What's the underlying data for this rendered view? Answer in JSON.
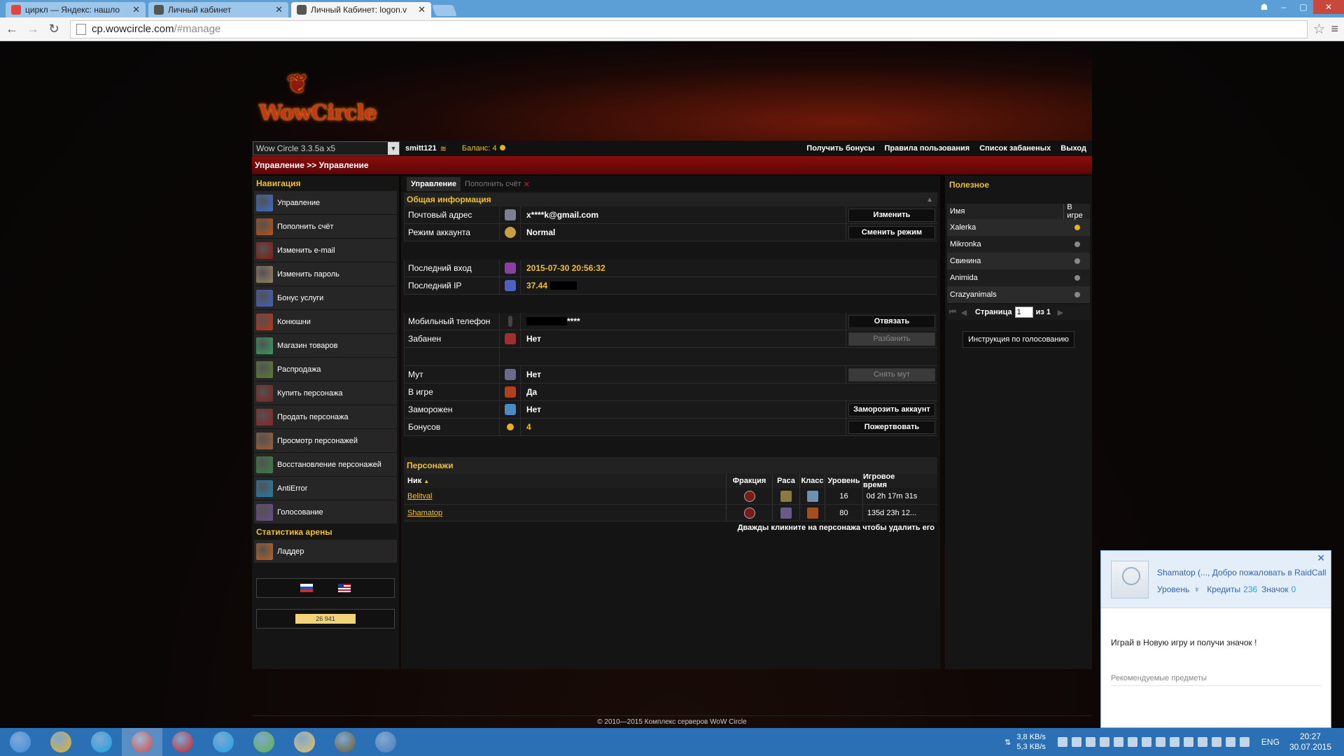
{
  "browser": {
    "tabs": [
      {
        "title": "циркл — Яндекс: нашло",
        "favicon_color": "#e0443a"
      },
      {
        "title": "Личный кабинет",
        "favicon_color": "#555555"
      },
      {
        "title": "Личный Кабинет: logon.v",
        "favicon_color": "#555555",
        "active": true
      }
    ],
    "url_host": "cp.wowcircle.com",
    "url_path": "/#manage"
  },
  "site": {
    "logo_text": "WowCircle",
    "realm": "Wow Circle 3.3.5a x5",
    "username": "smitt121",
    "balance_label": "Баланс:",
    "balance_value": "4",
    "top_menu": [
      "Получить бонусы",
      "Правила пользования",
      "Список забаненых",
      "Выход"
    ],
    "breadcrumb": "Управление >> Управление",
    "accent_color": "#f0c030",
    "header_red": "#8a0c0c"
  },
  "nav": {
    "title": "Навигация",
    "items": [
      {
        "label": "Управление",
        "icon": "manage-icon",
        "color": "#3a6bd0"
      },
      {
        "label": "Пополнить счёт",
        "icon": "deposit-icon",
        "color": "#c05010"
      },
      {
        "label": "Изменить e-mail",
        "icon": "email-icon",
        "color": "#8a1a10"
      },
      {
        "label": "Изменить пароль",
        "icon": "password-icon",
        "color": "#9a8060"
      },
      {
        "label": "Бонус услуги",
        "icon": "bonus-icon",
        "color": "#4060c0"
      },
      {
        "label": "Конюшни",
        "icon": "stable-icon",
        "color": "#c03010"
      },
      {
        "label": "Магазин товаров",
        "icon": "shop-icon",
        "color": "#30a060"
      },
      {
        "label": "Распродажа",
        "icon": "sale-icon",
        "color": "#5a8030"
      },
      {
        "label": "Купить персонажа",
        "icon": "buy-character-icon",
        "color": "#802020"
      },
      {
        "label": "Продать персонажа",
        "icon": "sell-character-icon",
        "color": "#902020"
      },
      {
        "label": "Просмотр персонажей",
        "icon": "view-characters-icon",
        "color": "#a06030"
      },
      {
        "label": "Восстановление персонажей",
        "icon": "restore-characters-icon",
        "color": "#3a8040"
      },
      {
        "label": "AntiError",
        "icon": "antierror-icon",
        "color": "#2080b0"
      },
      {
        "label": "Голосование",
        "icon": "vote-icon",
        "color": "#6a4a8a"
      }
    ],
    "arena_title": "Статистика арены",
    "arena_items": [
      {
        "label": "Ладдер",
        "icon": "ladder-icon",
        "color": "#c06020"
      }
    ],
    "counter_text": "26 941"
  },
  "center": {
    "tabs": [
      {
        "label": "Управление"
      },
      {
        "label": "Пополнить счёт"
      }
    ],
    "info_title": "Общая информация",
    "email": {
      "label": "Почтовый адрес",
      "value": "x****k@gmail.com",
      "button": "Изменить"
    },
    "mode": {
      "label": "Режим аккаунта",
      "value": "Normal",
      "button": "Сменить режим"
    },
    "last_login": {
      "label": "Последний вход",
      "value": "2015-07-30 20:56:32"
    },
    "last_ip": {
      "label": "Последний IP",
      "value": "37.44"
    },
    "phone": {
      "label": "Мобильный телефон",
      "value": "****",
      "button": "Отвязать"
    },
    "banned": {
      "label": "Забанен",
      "value": "Нет",
      "button": "Разбанить"
    },
    "mute": {
      "label": "Мут",
      "value": "Нет",
      "button": "Снять мут"
    },
    "ingame": {
      "label": "В игре",
      "value": "Да"
    },
    "frozen": {
      "label": "Заморожен",
      "value": "Нет",
      "button": "Заморозить аккаунт"
    },
    "bonuses": {
      "label": "Бонусов",
      "value": "4",
      "button": "Пожертвовать"
    },
    "chars_title": "Персонажи",
    "chars_headers": [
      "Ник",
      "Фракция",
      "Раса",
      "Класс",
      "Уровень",
      "Игровое время"
    ],
    "characters": [
      {
        "nick": "Belitval",
        "level": "16",
        "time": "0d 2h 17m 31s"
      },
      {
        "nick": "Shamatop",
        "level": "80",
        "time": "135d 23h 12..."
      }
    ],
    "chars_hint": "Дважды кликните на персонажа чтобы удалить его"
  },
  "right": {
    "title": "Полезное",
    "col_name": "Имя",
    "col_ingame": "В игре",
    "players": [
      {
        "name": "Xalerka",
        "online": true
      },
      {
        "name": "Mikronka",
        "online": false
      },
      {
        "name": "Свинина",
        "online": false
      },
      {
        "name": "Animida",
        "online": false
      },
      {
        "name": "Crazyanimals",
        "online": false
      }
    ],
    "page_label": "Страница",
    "page_value": "1",
    "page_of": "из 1",
    "vote_button": "Инструкция по голосованию"
  },
  "footer": "© 2010—2015 Комплекс серверов WoW Circle",
  "popup": {
    "title": "Shamatop (..., Добро пожаловать в RaidCall",
    "level_label": "Уровень",
    "credits_label": "Кредиты",
    "credits_value": "236",
    "badge_label": "Значок",
    "badge_value": "0",
    "promo": "Играй в Новую игру и получи значок !",
    "recommended": "Рекомендуемые предметы"
  },
  "taskbar": {
    "apps": [
      {
        "icon": "windows-start-icon",
        "color": "#3b8de0"
      },
      {
        "icon": "winamp-icon",
        "color": "#e8b020"
      },
      {
        "icon": "skype-icon",
        "color": "#1aa1e1"
      },
      {
        "icon": "chrome-icon",
        "color": "#db4437",
        "active": true
      },
      {
        "icon": "opera-icon",
        "color": "#cc1f1f"
      },
      {
        "icon": "skype-icon",
        "color": "#1aa1e1"
      },
      {
        "icon": "utorrent-icon",
        "color": "#5eb33e"
      },
      {
        "icon": "explorer-icon",
        "color": "#e8c060"
      },
      {
        "icon": "wow-icon",
        "color": "#6a5a2a"
      },
      {
        "icon": "raidcall-icon",
        "color": "#4a7ab8"
      }
    ],
    "net_down": "3,8 KB/s",
    "net_up": "5,3 KB/s",
    "lang": "ENG",
    "time": "20:27",
    "date": "30.07.2015"
  }
}
